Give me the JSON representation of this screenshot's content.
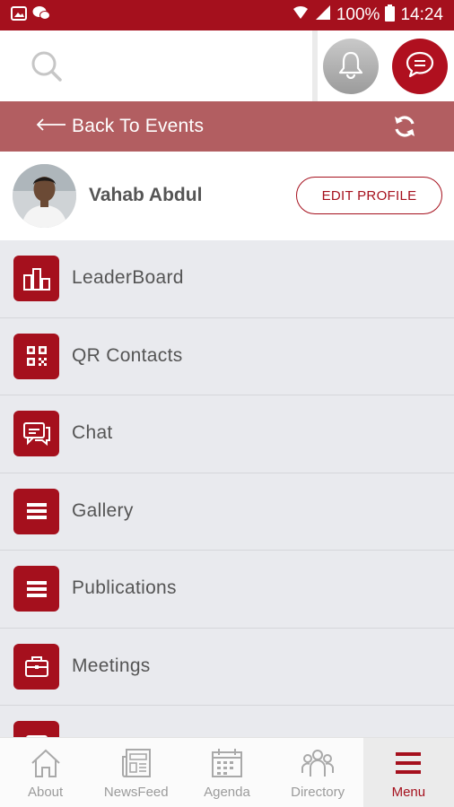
{
  "status_bar": {
    "battery": "100%",
    "time": "14:24"
  },
  "header": {
    "search_icon": "search-icon",
    "notification_icon": "bell-icon",
    "chat_icon": "chat-bubble-icon"
  },
  "back_bar": {
    "label": "Back To Events",
    "refresh_icon": "refresh-icon"
  },
  "profile": {
    "name": "Vahab Abdul",
    "edit_label": "EDIT PROFILE"
  },
  "menu": {
    "items": [
      {
        "label": "LeaderBoard",
        "icon": "leaderboard-icon"
      },
      {
        "label": "QR Contacts",
        "icon": "qr-code-icon"
      },
      {
        "label": "Chat",
        "icon": "chat-icon"
      },
      {
        "label": "Gallery",
        "icon": "list-icon"
      },
      {
        "label": "Publications",
        "icon": "list-icon"
      },
      {
        "label": "Meetings",
        "icon": "briefcase-icon"
      },
      {
        "label": "",
        "icon": "calendar-icon"
      }
    ]
  },
  "bottom_nav": {
    "tabs": [
      {
        "label": "About",
        "icon": "home-icon"
      },
      {
        "label": "NewsFeed",
        "icon": "newspaper-icon"
      },
      {
        "label": "Agenda",
        "icon": "calendar-icon"
      },
      {
        "label": "Directory",
        "icon": "people-icon"
      },
      {
        "label": "Menu",
        "icon": "hamburger-icon"
      }
    ],
    "active": "Menu"
  },
  "colors": {
    "brand": "#a5101d",
    "back_bar": "#b25e61",
    "list_bg": "#e9eaee",
    "text": "#555555"
  }
}
